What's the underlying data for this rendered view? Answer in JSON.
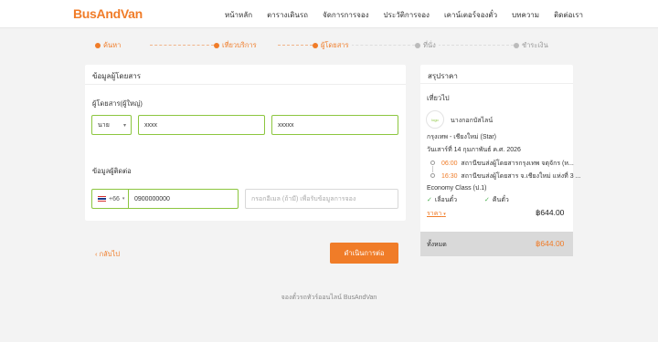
{
  "header": {
    "logo": "BusAndVan",
    "nav": [
      "หน้าหลัก",
      "ตารางเดินรถ",
      "จัดการการจอง",
      "ประวัติการจอง",
      "เคาน์เตอร์จองตั๋ว",
      "บทความ",
      "ติดต่อเรา"
    ]
  },
  "steps": [
    {
      "label": "ค้นหา",
      "state": "done"
    },
    {
      "label": "เที่ยวบริการ",
      "state": "done"
    },
    {
      "label": "ผู้โดยสาร",
      "state": "current"
    },
    {
      "label": "ที่นั่ง",
      "state": "pending"
    },
    {
      "label": "ชำระเงิน",
      "state": "pending"
    }
  ],
  "passenger": {
    "section_title": "ข้อมูลผู้โดยสาร",
    "subtitle": "ผู้โดยสาร(ผู้ใหญ่)",
    "title_select": "นาย",
    "first_name": "xxxx",
    "last_name": "xxxxx"
  },
  "contact": {
    "section_title": "ข้อมูลผู้ติดต่อ",
    "country_code": "+66",
    "phone": "0900000000",
    "email_placeholder": "กรอกอีเมล (ถ้ามี) เพื่อรับข้อมูลการจอง"
  },
  "actions": {
    "back": "กลับไป",
    "continue": "ดำเนินการต่อ"
  },
  "footer": "จองตั๋วรถทัวร์ออนไลน์ BusAndVan",
  "summary": {
    "title": "สรุปราคา",
    "trip_label": "เที่ยวไป",
    "operator": "นางกอกบัสไลน์",
    "operator_logo_text": "logo",
    "route": "กรุงเทพ - เชียงใหม่ (Star)",
    "date": "วันเสาร์ที่ 14 กุมภาพันธ์ ค.ศ. 2026",
    "depart_time": "06:00",
    "depart_place": "สถานีขนส่งผู้โดยสารกรุงเทพ จตุจักร (ห...",
    "arrive_time": "16:30",
    "arrive_place": "สถานีขนส่งผู้โดยสาร จ.เชียงใหม่ แห่งที่ 3 ...",
    "class": "Economy Class (ป.1)",
    "feature_1": "เลื่อนตั๋ว",
    "feature_2": "คืนตั๋ว",
    "price_label": "ราคา",
    "price": "฿644.00",
    "total_label": "ทั้งหมด",
    "total": "฿644.00"
  },
  "colors": {
    "accent": "#f07c28",
    "valid_border": "#8cc63f",
    "check": "#4caf50"
  }
}
